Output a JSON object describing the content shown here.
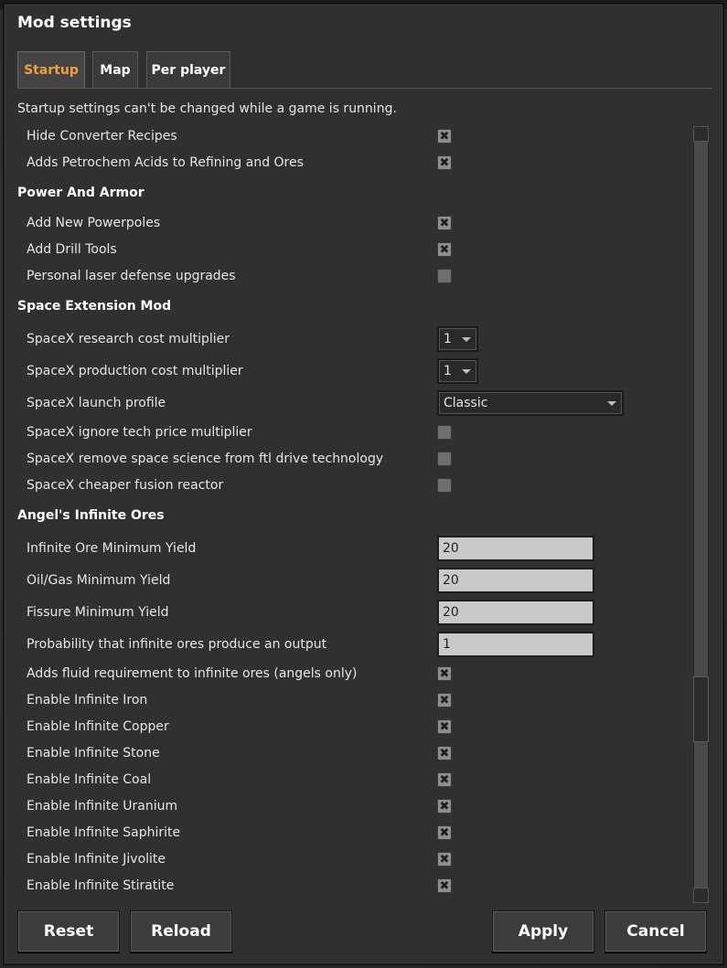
{
  "window": {
    "title": "Mod settings"
  },
  "tabs": [
    {
      "label": "Startup",
      "active": true
    },
    {
      "label": "Map",
      "active": false
    },
    {
      "label": "Per player",
      "active": false
    }
  ],
  "notice": "Startup settings can't be changed while a game is running.",
  "settings": {
    "hide_converter": {
      "label": "Hide Converter Recipes",
      "checked": true
    },
    "petrochem_acids": {
      "label": "Adds Petrochem Acids to Refining and Ores",
      "checked": true
    },
    "group_power": "Power And Armor",
    "powerpoles": {
      "label": "Add New Powerpoles",
      "checked": true
    },
    "drill_tools": {
      "label": "Add Drill Tools",
      "checked": true
    },
    "laser_defense": {
      "label": "Personal laser defense upgrades",
      "checked": false
    },
    "group_spacex": "Space Extension Mod",
    "research_mult": {
      "label": "SpaceX research cost multiplier",
      "value": "1"
    },
    "production_mult": {
      "label": "SpaceX production cost multiplier",
      "value": "1"
    },
    "launch_profile": {
      "label": "SpaceX launch profile",
      "value": "Classic"
    },
    "ignore_tech": {
      "label": "SpaceX ignore tech price multiplier",
      "checked": false
    },
    "remove_space_science": {
      "label": "SpaceX remove space science from ftl drive technology",
      "checked": false
    },
    "cheaper_fusion": {
      "label": "SpaceX cheaper fusion reactor",
      "checked": false
    },
    "group_angels": "Angel's Infinite Ores",
    "ore_min_yield": {
      "label": "Infinite Ore Minimum Yield",
      "value": "20"
    },
    "oilgas_min_yield": {
      "label": "Oil/Gas Minimum Yield",
      "value": "20"
    },
    "fissure_min_yield": {
      "label": "Fissure Minimum Yield",
      "value": "20"
    },
    "probability_output": {
      "label": "Probability that infinite ores produce an output",
      "value": "1"
    },
    "fluid_requirement": {
      "label": "Adds fluid requirement to infinite ores (angels only)",
      "checked": true
    },
    "inf_iron": {
      "label": "Enable Infinite Iron",
      "checked": true
    },
    "inf_copper": {
      "label": "Enable Infinite Copper",
      "checked": true
    },
    "inf_stone": {
      "label": "Enable Infinite Stone",
      "checked": true
    },
    "inf_coal": {
      "label": "Enable Infinite Coal",
      "checked": true
    },
    "inf_uranium": {
      "label": "Enable Infinite Uranium",
      "checked": true
    },
    "inf_saphirite": {
      "label": "Enable Infinite Saphirite",
      "checked": true
    },
    "inf_jivolite": {
      "label": "Enable Infinite Jivolite",
      "checked": true
    },
    "inf_stiratite": {
      "label": "Enable Infinite Stiratite",
      "checked": true
    }
  },
  "checkmark_glyph": "✖",
  "buttons": {
    "reset": "Reset",
    "reload": "Reload",
    "apply": "Apply",
    "cancel": "Cancel"
  },
  "colors": {
    "active_tab": "#f0a03c",
    "panel": "#313031",
    "checkbox": "#8e8e8e"
  }
}
